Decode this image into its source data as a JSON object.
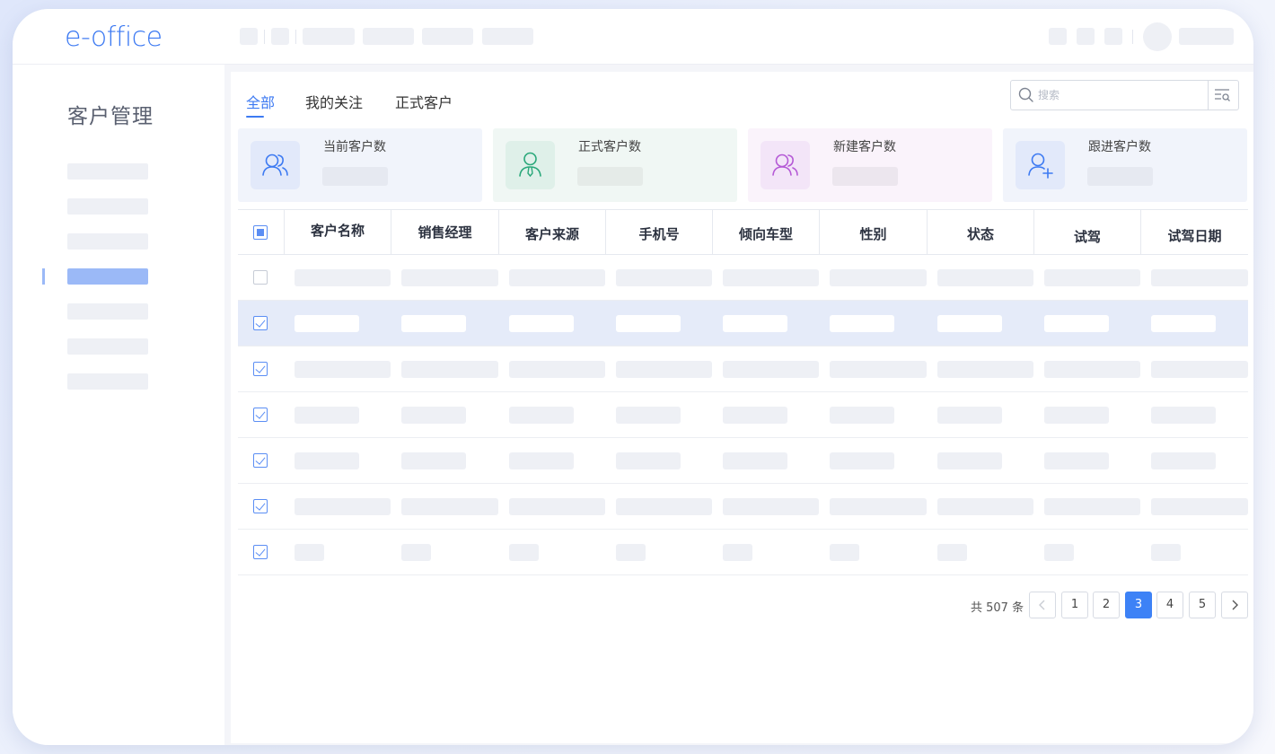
{
  "app": {
    "logo_text": "e-office"
  },
  "colors": {
    "accent": "#3d7af2",
    "selected_row": "#e5ebf9",
    "sidebar_active": "#9bb9f7"
  },
  "sidebar": {
    "title": "客户管理"
  },
  "tabs": [
    {
      "label": "全部",
      "active": true
    },
    {
      "label": "我的关注",
      "active": false
    },
    {
      "label": "正式客户",
      "active": false
    }
  ],
  "search": {
    "placeholder": "搜索",
    "value": "",
    "icon": "search-icon",
    "filter_icon": "filter-list-icon"
  },
  "stats": [
    {
      "label": "当前客户数",
      "icon": "users-icon",
      "color": "#3d7af2",
      "bg": "#eef2fc"
    },
    {
      "label": "正式客户数",
      "icon": "user-tie-icon",
      "color": "#2aa87a",
      "bg": "#eef8f4"
    },
    {
      "label": "新建客户数",
      "icon": "users-icon",
      "color": "#b55ad6",
      "bg": "#f9f2fb"
    },
    {
      "label": "跟进客户数",
      "icon": "user-plus-icon",
      "color": "#3d7af2",
      "bg": "#eef2fc"
    }
  ],
  "table": {
    "columns": [
      "客户名称",
      "销售经理",
      "客户来源",
      "手机号",
      "倾向车型",
      "性别",
      "状态",
      "试驾",
      "试驾日期"
    ],
    "header_checkbox": "indeterminate",
    "rows": [
      {
        "checked": false,
        "highlighted": false
      },
      {
        "checked": true,
        "highlighted": true
      },
      {
        "checked": true,
        "highlighted": false
      },
      {
        "checked": true,
        "highlighted": false
      },
      {
        "checked": true,
        "highlighted": false
      },
      {
        "checked": true,
        "highlighted": false
      },
      {
        "checked": true,
        "highlighted": false
      }
    ]
  },
  "pagination": {
    "total_text": "共 507 条",
    "pages": [
      "1",
      "2",
      "3",
      "4",
      "5"
    ],
    "current": "3",
    "prev_icon": "chevron-left-icon",
    "next_icon": "chevron-right-icon"
  }
}
